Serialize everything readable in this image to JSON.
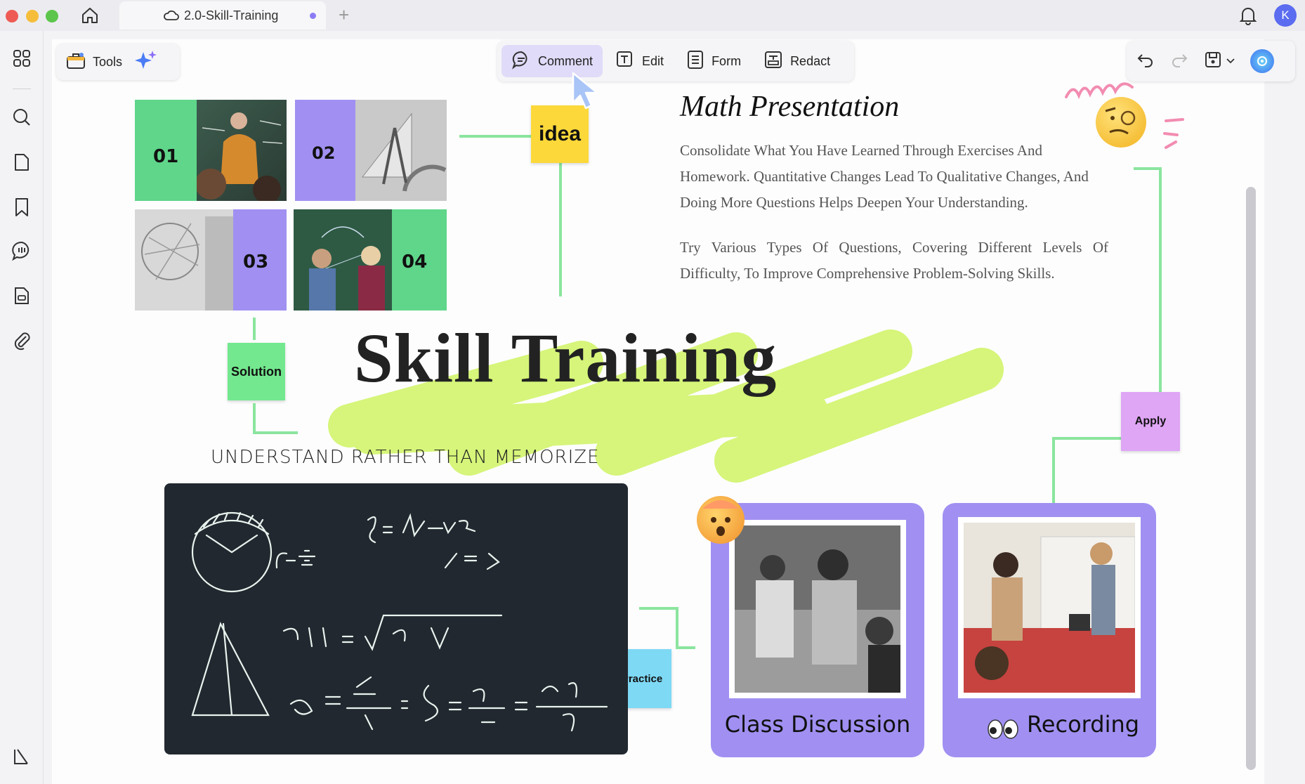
{
  "titlebar": {
    "tab_title": "2.0-Skill-Training",
    "new_tab_symbol": "+",
    "avatar_letter": "K"
  },
  "toolbar_left": {
    "tools_label": "Tools"
  },
  "toolbar_center": {
    "comment_label": "Comment",
    "edit_label": "Edit",
    "form_label": "Form",
    "redact_label": "Redact"
  },
  "document": {
    "grid_numbers": [
      "01",
      "02",
      "03",
      "04"
    ],
    "idea_note": "idea",
    "solution_note": "Solution",
    "apply_note": "Apply",
    "practice_note": "Practice",
    "math_title": "Math Presentation",
    "paragraph1": "Consolidate What You Have Learned Through Exercises And Homework. Quantitative Changes Lead To Qualitative Changes, And Doing More Questions Helps Deepen Your Understanding.",
    "paragraph2": "Try Various Types Of Questions, Covering Different Levels Of Difficulty, To Improve Comprehensive Problem-Solving Skills.",
    "main_title": "Skill Training",
    "subtitle": "UNDERSTAND RATHER THAN MEMORIZE",
    "card1_caption": "Class Discussion",
    "card2_caption": "Recording"
  },
  "colors": {
    "accent_purple": "#a190f2",
    "accent_green": "#5fd68a",
    "highlight_lime": "#d6f57a",
    "blackboard": "#22282f",
    "note_yellow": "#fcd83a",
    "note_cyan": "#7ed9f5",
    "note_violet": "#dfa6f5"
  }
}
